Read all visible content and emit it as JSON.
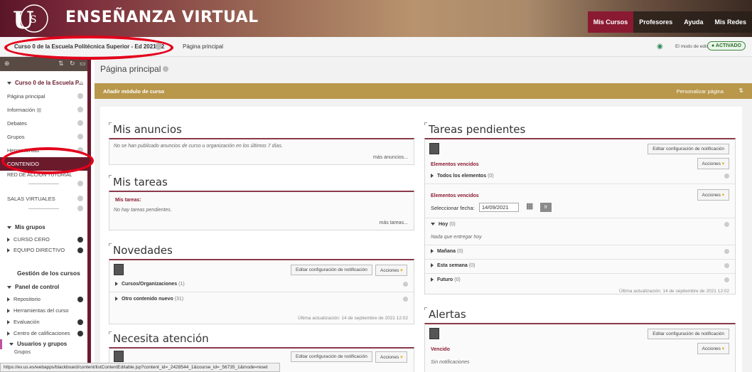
{
  "header": {
    "title": "ENSEÑANZA VIRTUAL",
    "nav": [
      "Mis Cursos",
      "Profesores",
      "Ayuda",
      "Mis Redes"
    ]
  },
  "breadcrumb": {
    "course": "Curso 0 de la Escuela Politécnica Superior - Ed 2021-22",
    "page": "Página principal",
    "edit_mode_label": "El modo de edición está:",
    "edit_mode_value": "ACTIVADO"
  },
  "sidebar": {
    "course_head": "Curso 0 de la Escuela P...",
    "items": [
      "Página principal",
      "Información",
      "Debates",
      "Grupos",
      "Herramientas",
      "CONTENIDO",
      "RED DE ACCIÓN TUTORIAL",
      "SALAS VIRTUALES"
    ],
    "mis_grupos": "Mis grupos",
    "groups": [
      "CURSO CERO",
      "EQUIPO DIRECTIVO"
    ],
    "gestion": "Gestión de los cursos",
    "panel": "Panel de control",
    "panel_items": [
      "Repositorio",
      "Herramientas del curso",
      "Evaluación",
      "Centro de calificaciones"
    ],
    "usuarios": "Usuarios y grupos",
    "grupos_sub": "Grupos"
  },
  "main": {
    "page_title": "Página principal",
    "add_module": "Añadir módulo de curso",
    "customize": "Personalizar página"
  },
  "anuncios": {
    "title": "Mis anuncios",
    "text": "No se han publicado anuncios de curso u organización en los últimos 7 días.",
    "more": "más anuncios..."
  },
  "tareas": {
    "title": "Mis tareas",
    "label": "Mis tareas:",
    "text": "No hay tareas pendientes.",
    "more": "más tareas..."
  },
  "novedades": {
    "title": "Novedades",
    "edit_btn": "Editar configuración de notificación",
    "actions": "Acciones",
    "rows": [
      {
        "label": "Cursos/Organizaciones",
        "count": "(1)"
      },
      {
        "label": "Otro contenido nuevo",
        "count": "(31)"
      }
    ],
    "update": "Última actualización: 14 de septiembre de 2021 12:02"
  },
  "atencion": {
    "title": "Necesita atención",
    "edit_btn": "Editar configuración de notificación",
    "actions": "Acciones"
  },
  "pendientes": {
    "title": "Tareas pendientes",
    "edit_btn": "Editar configuración de notificación",
    "actions": "Acciones",
    "overdue": "Elementos vencidos",
    "all_items": "Todos los elementos",
    "all_count": "(0)",
    "overdue2": "Elementos vencidos",
    "date_label": "Seleccionar fecha:",
    "date_value": "14/09/2021",
    "go": "Ir",
    "hoy": "Hoy",
    "hoy_count": "(0)",
    "nada": "Nada que entregar hoy",
    "rows": [
      {
        "label": "Mañana",
        "count": "(0)"
      },
      {
        "label": "Esta semana",
        "count": "(0)"
      },
      {
        "label": "Futuro",
        "count": "(0)"
      }
    ],
    "update": "Última actualización: 14 de septiembre de 2021 12:02"
  },
  "alertas": {
    "title": "Alertas",
    "edit_btn": "Editar configuración de notificación",
    "actions": "Acciones",
    "vencido": "Vencido",
    "sin": "Sin notificaciones"
  },
  "status_url": "https://ev.us.es/webapps/blackboard/content/listContentEditable.jsp?content_id=_2428544_1&course_id=_56735_1&mode=reset"
}
